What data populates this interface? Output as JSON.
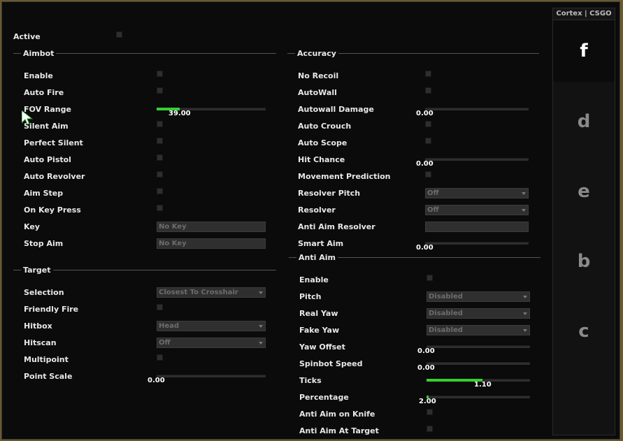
{
  "brand": "Cortex | CSGO",
  "tabs": [
    "f",
    "d",
    "e",
    "b",
    "c"
  ],
  "active": {
    "label": "Active",
    "checked": false
  },
  "aimbot": {
    "title": "Aimbot",
    "enable": "Enable",
    "auto_fire": "Auto Fire",
    "fov_range": {
      "label": "FOV Range",
      "value": "39.00",
      "fraction": 0.21
    },
    "silent_aim": "Silent Aim",
    "perfect_silent": "Perfect Silent",
    "auto_pistol": "Auto Pistol",
    "auto_revolver": "Auto Revolver",
    "aim_step": "Aim Step",
    "on_key_press": "On Key Press",
    "key": {
      "label": "Key",
      "value": "No Key"
    },
    "stop_aim": {
      "label": "Stop Aim",
      "value": "No Key"
    }
  },
  "target": {
    "title": "Target",
    "selection": {
      "label": "Selection",
      "value": "Closest To Crosshair"
    },
    "friendly_fire": "Friendly Fire",
    "hitbox": {
      "label": "Hitbox",
      "value": "Head"
    },
    "hitscan": {
      "label": "Hitscan",
      "value": "Off"
    },
    "multipoint": "Multipoint",
    "point_scale": {
      "label": "Point Scale",
      "value": "0.00",
      "fraction": 0
    }
  },
  "accuracy": {
    "title": "Accuracy",
    "no_recoil": "No Recoil",
    "autowall": "AutoWall",
    "autowall_damage": {
      "label": "Autowall Damage",
      "value": "0.00",
      "fraction": 0
    },
    "auto_crouch": "Auto Crouch",
    "auto_scope": "Auto Scope",
    "hit_chance": {
      "label": "Hit Chance",
      "value": "0.00",
      "fraction": 0
    },
    "movement_prediction": "Movement Prediction",
    "resolver_pitch": {
      "label": "Resolver Pitch",
      "value": "Off"
    },
    "resolver": {
      "label": "Resolver",
      "value": "Off"
    },
    "anti_aim_resolver": {
      "label": "Anti Aim Resolver",
      "value": ""
    },
    "smart_aim": {
      "label": "Smart Aim",
      "value": "0.00",
      "fraction": 0
    }
  },
  "anti_aim": {
    "title": "Anti Aim",
    "enable": "Enable",
    "pitch": {
      "label": "Pitch",
      "value": "Disabled"
    },
    "real_yaw": {
      "label": "Real Yaw",
      "value": "Disabled"
    },
    "fake_yaw": {
      "label": "Fake Yaw",
      "value": "Disabled"
    },
    "yaw_offset": {
      "label": "Yaw Offset",
      "value": "0.00",
      "fraction": 0
    },
    "spinbot_speed": {
      "label": "Spinbot Speed",
      "value": "0.00",
      "fraction": 0
    },
    "ticks": {
      "label": "Ticks",
      "value": "1.10",
      "fraction": 0.54
    },
    "percentage": {
      "label": "Percentage",
      "value": "2.00",
      "fraction": 0.02
    },
    "anti_aim_on_knife": "Anti Aim on Knife",
    "anti_aim_at_target": "Anti Aim At Target"
  },
  "colors": {
    "accent": "#35d030",
    "background": "#0b0b0b",
    "control": "#2e2e2e"
  }
}
